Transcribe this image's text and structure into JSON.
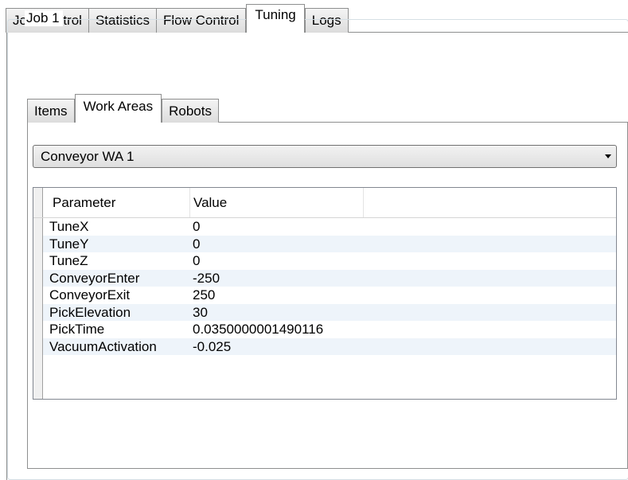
{
  "top_tabs": [
    "Job Control",
    "Statistics",
    "Flow Control",
    "Tuning",
    "Logs"
  ],
  "active_top_tab": "Tuning",
  "group": {
    "title": "Job 1"
  },
  "inner_tabs": [
    "Items",
    "Work Areas",
    "Robots"
  ],
  "active_inner_tab": "Work Areas",
  "work_area_select": {
    "value": "Conveyor WA 1"
  },
  "grid": {
    "columns": [
      "Parameter",
      "Value"
    ],
    "rows": [
      {
        "parameter": "TuneX",
        "value": "0"
      },
      {
        "parameter": "TuneY",
        "value": "0"
      },
      {
        "parameter": "TuneZ",
        "value": "0"
      },
      {
        "parameter": "ConveyorEnter",
        "value": "-250"
      },
      {
        "parameter": "ConveyorExit",
        "value": "250"
      },
      {
        "parameter": "PickElevation",
        "value": "30"
      },
      {
        "parameter": "PickTime",
        "value": "0.0350000001490116"
      },
      {
        "parameter": "VacuumActivation",
        "value": "-0.025"
      }
    ]
  }
}
